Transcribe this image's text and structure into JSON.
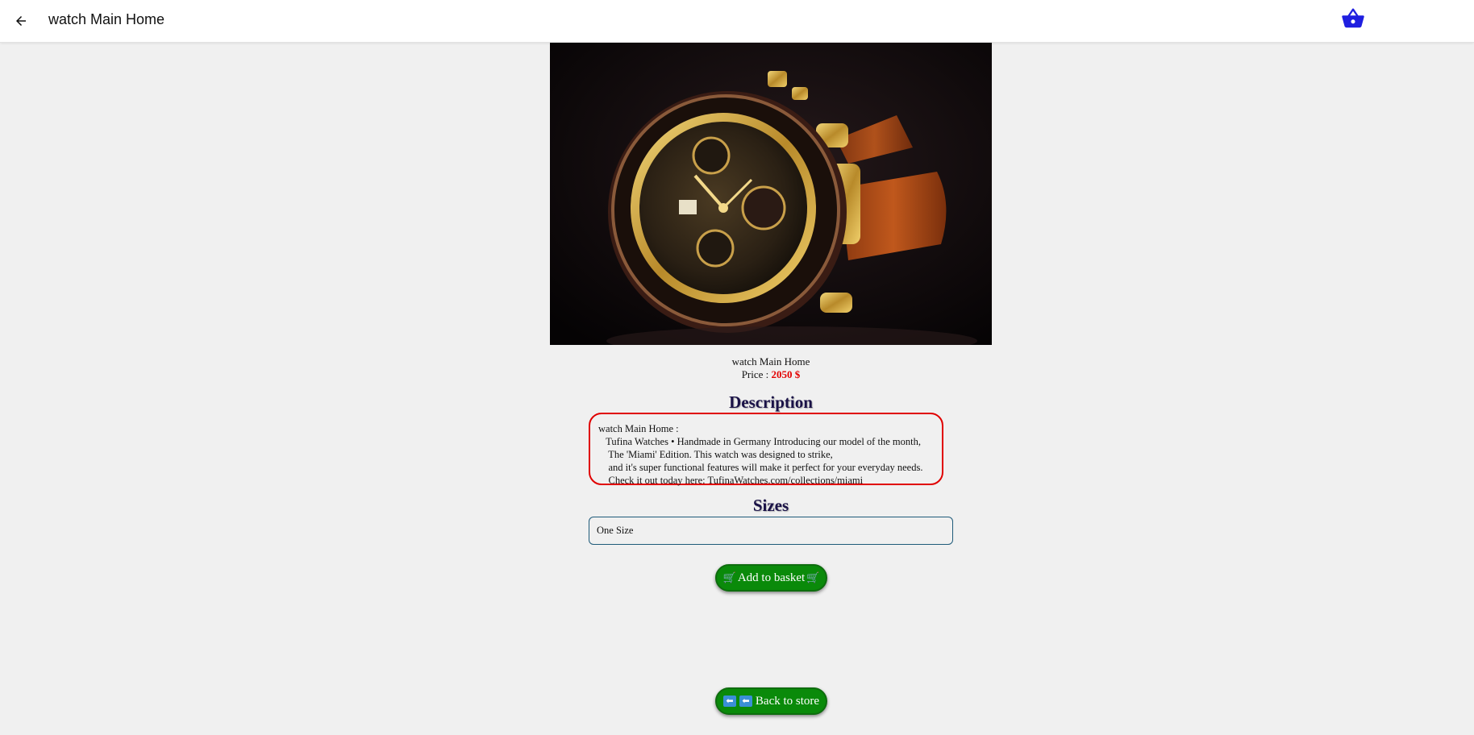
{
  "appbar": {
    "title": "watch Main Home",
    "back_icon": "arrow-left-icon",
    "basket_icon": "basket-icon",
    "basket_color": "#1f1fe0"
  },
  "product": {
    "image_alt": "Gold chronograph watch with brown leather strap",
    "name": "watch Main Home",
    "price_label": "Price :",
    "price_value": "2050 $",
    "price_color": "#e30000"
  },
  "description": {
    "heading": "Description",
    "lines": [
      "watch Main Home :",
      "   Tufina Watches • Handmade in Germany Introducing our model of the month,",
      "    The 'Miami' Edition. This watch was designed to strike,",
      "    and it's super functional features will make it perfect for your everyday needs.",
      "    Check it out today here: TufinaWatches.com/collections/miami"
    ]
  },
  "sizes": {
    "heading": "Sizes",
    "selected": "One Size"
  },
  "buttons": {
    "add_to_basket": "Add to basket",
    "back_to_store": "Back to store",
    "cart_glyph": "🛒",
    "back_glyph": "⬅"
  }
}
